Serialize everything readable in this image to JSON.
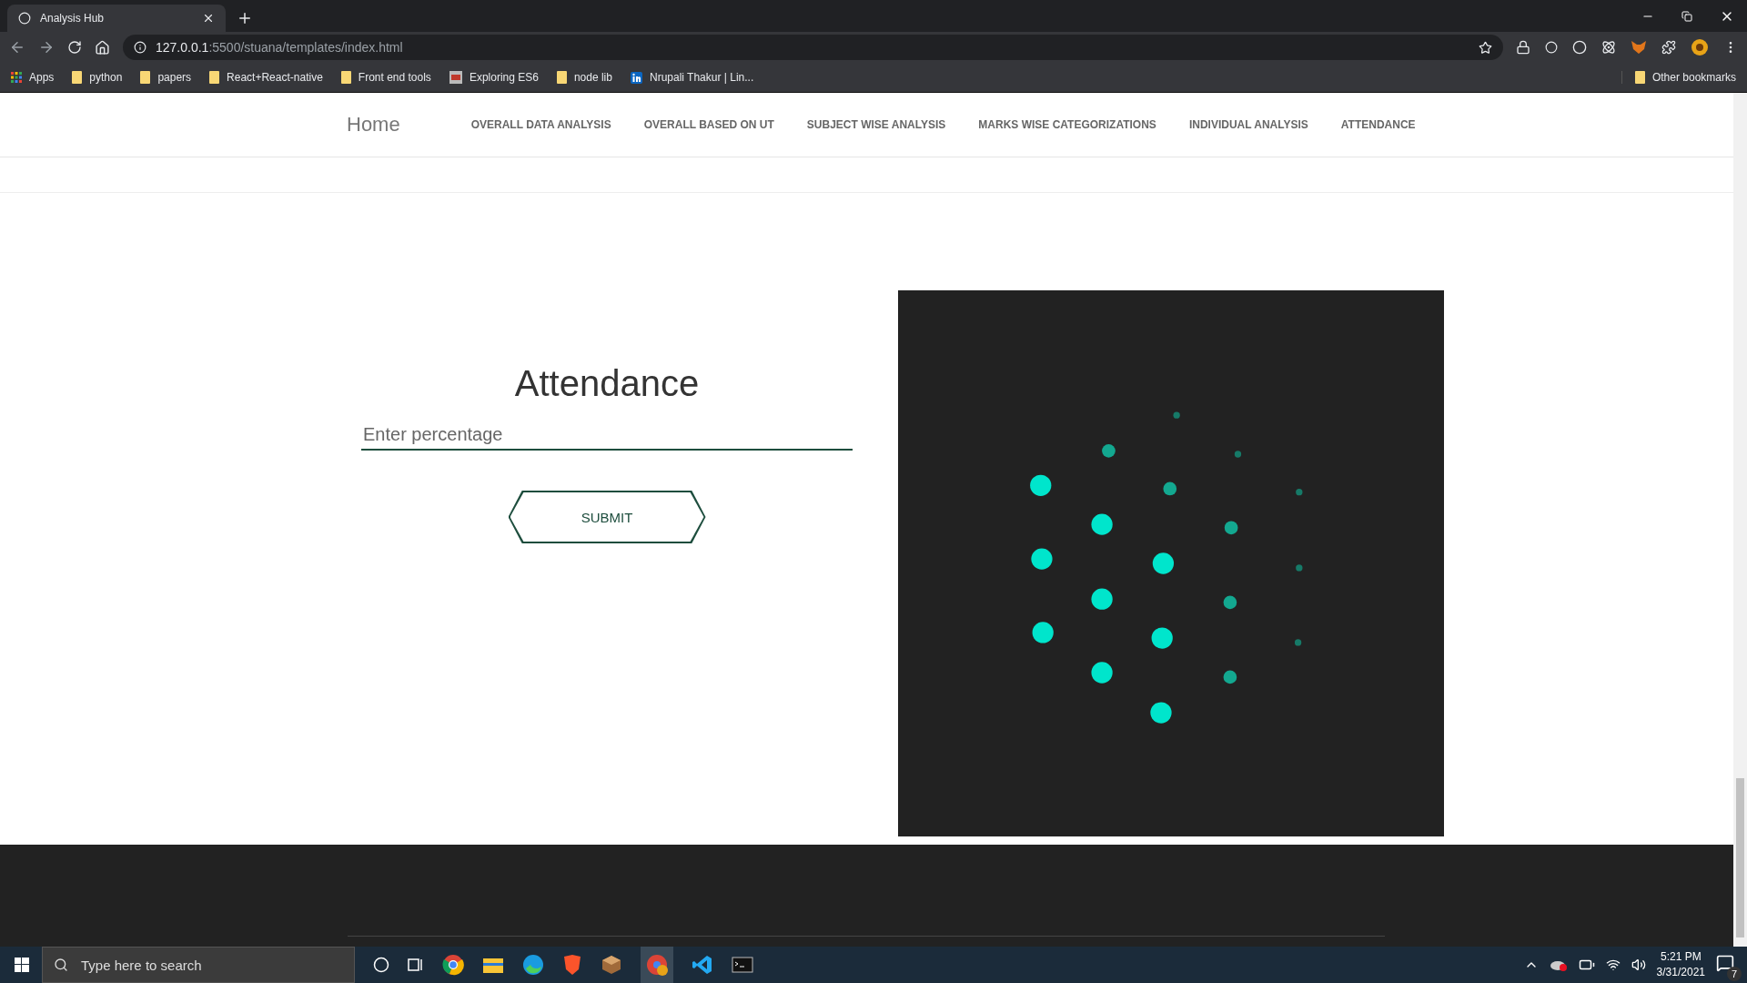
{
  "browser": {
    "tab_title": "Analysis Hub",
    "url_host": "127.0.0.1",
    "url_path": ":5500/stuana/templates/index.html",
    "bookmarks": [
      {
        "kind": "apps",
        "label": "Apps"
      },
      {
        "kind": "folder",
        "label": "python"
      },
      {
        "kind": "folder",
        "label": "papers"
      },
      {
        "kind": "folder",
        "label": "React+React-native"
      },
      {
        "kind": "folder",
        "label": "Front end tools"
      },
      {
        "kind": "es6",
        "label": "Exploring ES6"
      },
      {
        "kind": "folder",
        "label": "node lib"
      },
      {
        "kind": "linkedin",
        "label": "Nrupali Thakur | Lin..."
      }
    ],
    "other_bookmarks": "Other bookmarks"
  },
  "nav": {
    "brand": "Home",
    "links": [
      "OVERALL DATA ANALYSIS",
      "OVERALL BASED ON UT",
      "SUBJECT WISE ANALYSIS",
      "MARKS WISE CATEGORIZATIONS",
      "INDIVIDUAL ANALYSIS",
      "ATTENDANCE"
    ]
  },
  "attendance": {
    "title": "Attendance",
    "placeholder": "Enter percentage",
    "submit": "SUBMIT"
  },
  "taskbar": {
    "search_placeholder": "Type here to search",
    "time": "5:21 PM",
    "date": "3/31/2021",
    "notifications": "7"
  }
}
